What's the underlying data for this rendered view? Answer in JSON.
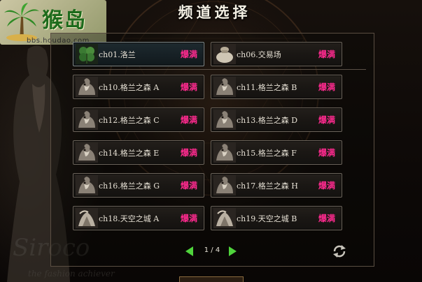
{
  "window": {
    "title": "频道选择"
  },
  "watermark": {
    "logo_text": "猴岛",
    "url": "bbs.houdao.com"
  },
  "background": {
    "signature": "Siroco",
    "signature_sub": "the fashion achiever"
  },
  "channels": [
    {
      "name": "ch01.洛兰",
      "status": "爆满",
      "icon": "clover-icon",
      "selected": true
    },
    {
      "name": "ch06.交易场",
      "status": "爆满",
      "icon": "money-bag-icon",
      "selected": false
    },
    {
      "name": "ch10.格兰之森 A",
      "status": "爆满",
      "icon": "beast-icon",
      "selected": false
    },
    {
      "name": "ch11.格兰之森 B",
      "status": "爆满",
      "icon": "beast-icon",
      "selected": false
    },
    {
      "name": "ch12.格兰之森 C",
      "status": "爆满",
      "icon": "beast-icon",
      "selected": false
    },
    {
      "name": "ch13.格兰之森 D",
      "status": "爆满",
      "icon": "beast-icon",
      "selected": false
    },
    {
      "name": "ch14.格兰之森 E",
      "status": "爆满",
      "icon": "beast-icon",
      "selected": false
    },
    {
      "name": "ch15.格兰之森 F",
      "status": "爆满",
      "icon": "beast-icon",
      "selected": false
    },
    {
      "name": "ch16.格兰之森 G",
      "status": "爆满",
      "icon": "beast-icon",
      "selected": false
    },
    {
      "name": "ch17.格兰之森 H",
      "status": "爆满",
      "icon": "beast-icon",
      "selected": false
    },
    {
      "name": "ch18.天空之城 A",
      "status": "爆满",
      "icon": "sky-castle-icon",
      "selected": false
    },
    {
      "name": "ch19.天空之城 B",
      "status": "爆满",
      "icon": "sky-castle-icon",
      "selected": false
    }
  ],
  "pagination": {
    "label": "1 / 4",
    "current": 1,
    "total": 4,
    "prev_icon": "arrow-left-icon",
    "next_icon": "arrow-right-icon"
  },
  "refresh_icon": "refresh-icon",
  "colors": {
    "status_full": "#ff2a8f",
    "pager_arrow": "#4fd43c",
    "title_text": "#f4f0e4"
  }
}
